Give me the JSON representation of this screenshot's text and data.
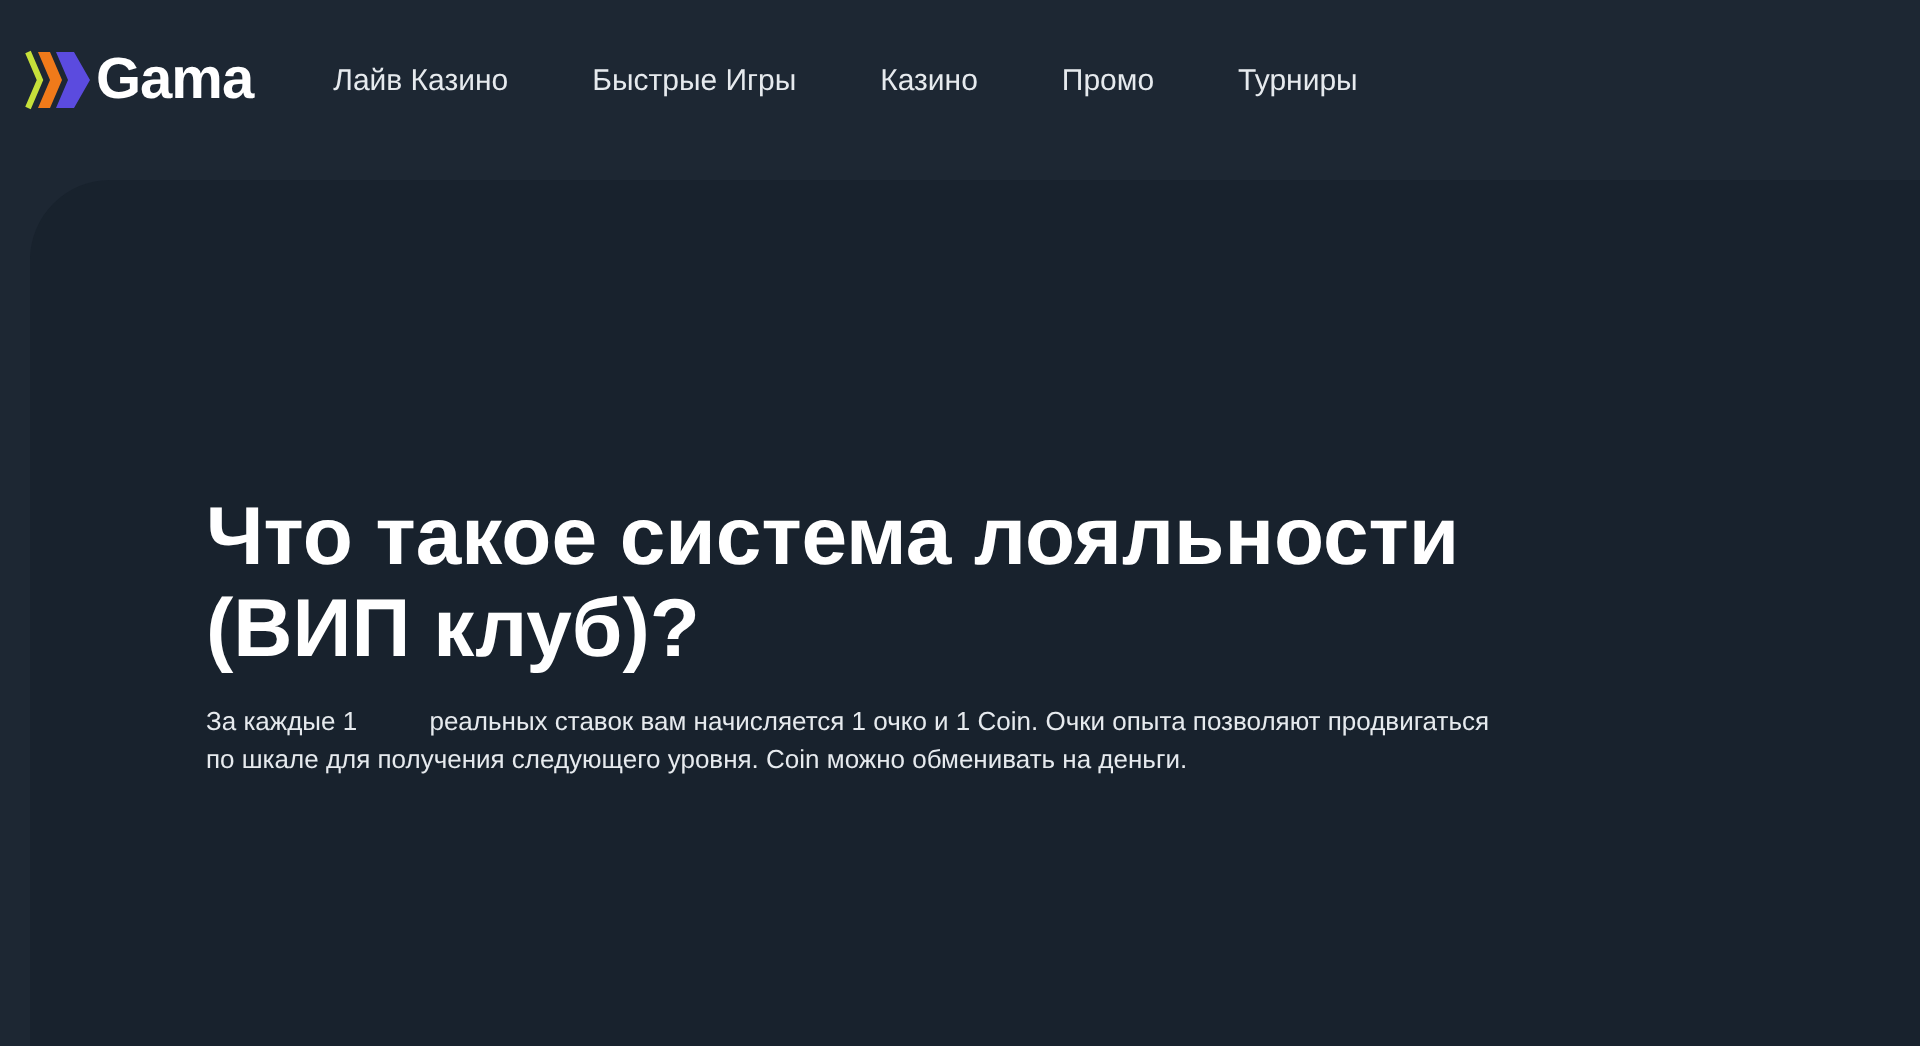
{
  "header": {
    "logo": "Gama",
    "nav": [
      {
        "label": "Лайв Казино"
      },
      {
        "label": "Быстрые Игры"
      },
      {
        "label": "Казино"
      },
      {
        "label": "Промо"
      },
      {
        "label": "Турниры"
      }
    ]
  },
  "hero": {
    "title": "Что такое система лояльности (ВИП клуб)?",
    "description_lines": [
      "За каждые 1          реальных ставок вам начисляется 1 очко и 1 Coin. Очки опыта позволяют продвигаться",
      "по шкале для получения следующего уровня. Coin можно обменивать на деньги."
    ]
  }
}
